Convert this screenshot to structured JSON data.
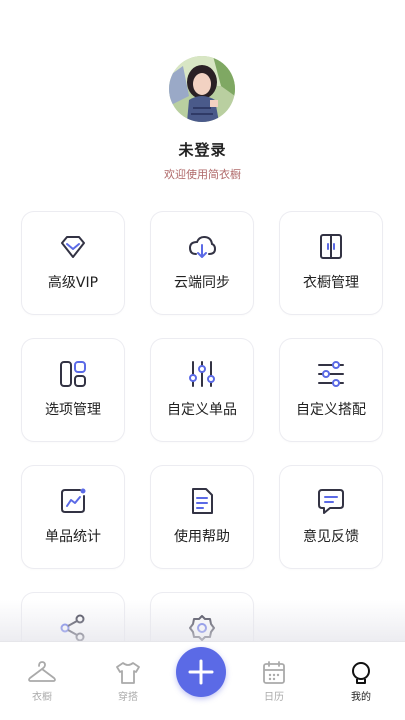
{
  "profile": {
    "name": "未登录",
    "welcome": "欢迎使用简衣橱"
  },
  "menu": [
    {
      "label": "高级VIP",
      "icon": "diamond-icon"
    },
    {
      "label": "云端同步",
      "icon": "cloud-sync-icon"
    },
    {
      "label": "衣橱管理",
      "icon": "wardrobe-icon"
    },
    {
      "label": "选项管理",
      "icon": "options-grid-icon"
    },
    {
      "label": "自定义单品",
      "icon": "sliders-icon"
    },
    {
      "label": "自定义搭配",
      "icon": "filter-lines-icon"
    },
    {
      "label": "单品统计",
      "icon": "chart-icon"
    },
    {
      "label": "使用帮助",
      "icon": "help-doc-icon"
    },
    {
      "label": "意见反馈",
      "icon": "feedback-icon"
    },
    {
      "label": "",
      "icon": "share-icon"
    },
    {
      "label": "",
      "icon": "settings-icon"
    }
  ],
  "tabbar": {
    "tabs": [
      {
        "label": "衣橱",
        "icon": "hanger-icon"
      },
      {
        "label": "穿搭",
        "icon": "tshirt-icon"
      },
      {
        "label": "日历",
        "icon": "calendar-icon"
      },
      {
        "label": "我的",
        "icon": "profile-bulb-icon"
      }
    ],
    "add_icon": "plus-icon"
  },
  "colors": {
    "accent": "#5b6ae6",
    "icon_dark": "#333344"
  }
}
